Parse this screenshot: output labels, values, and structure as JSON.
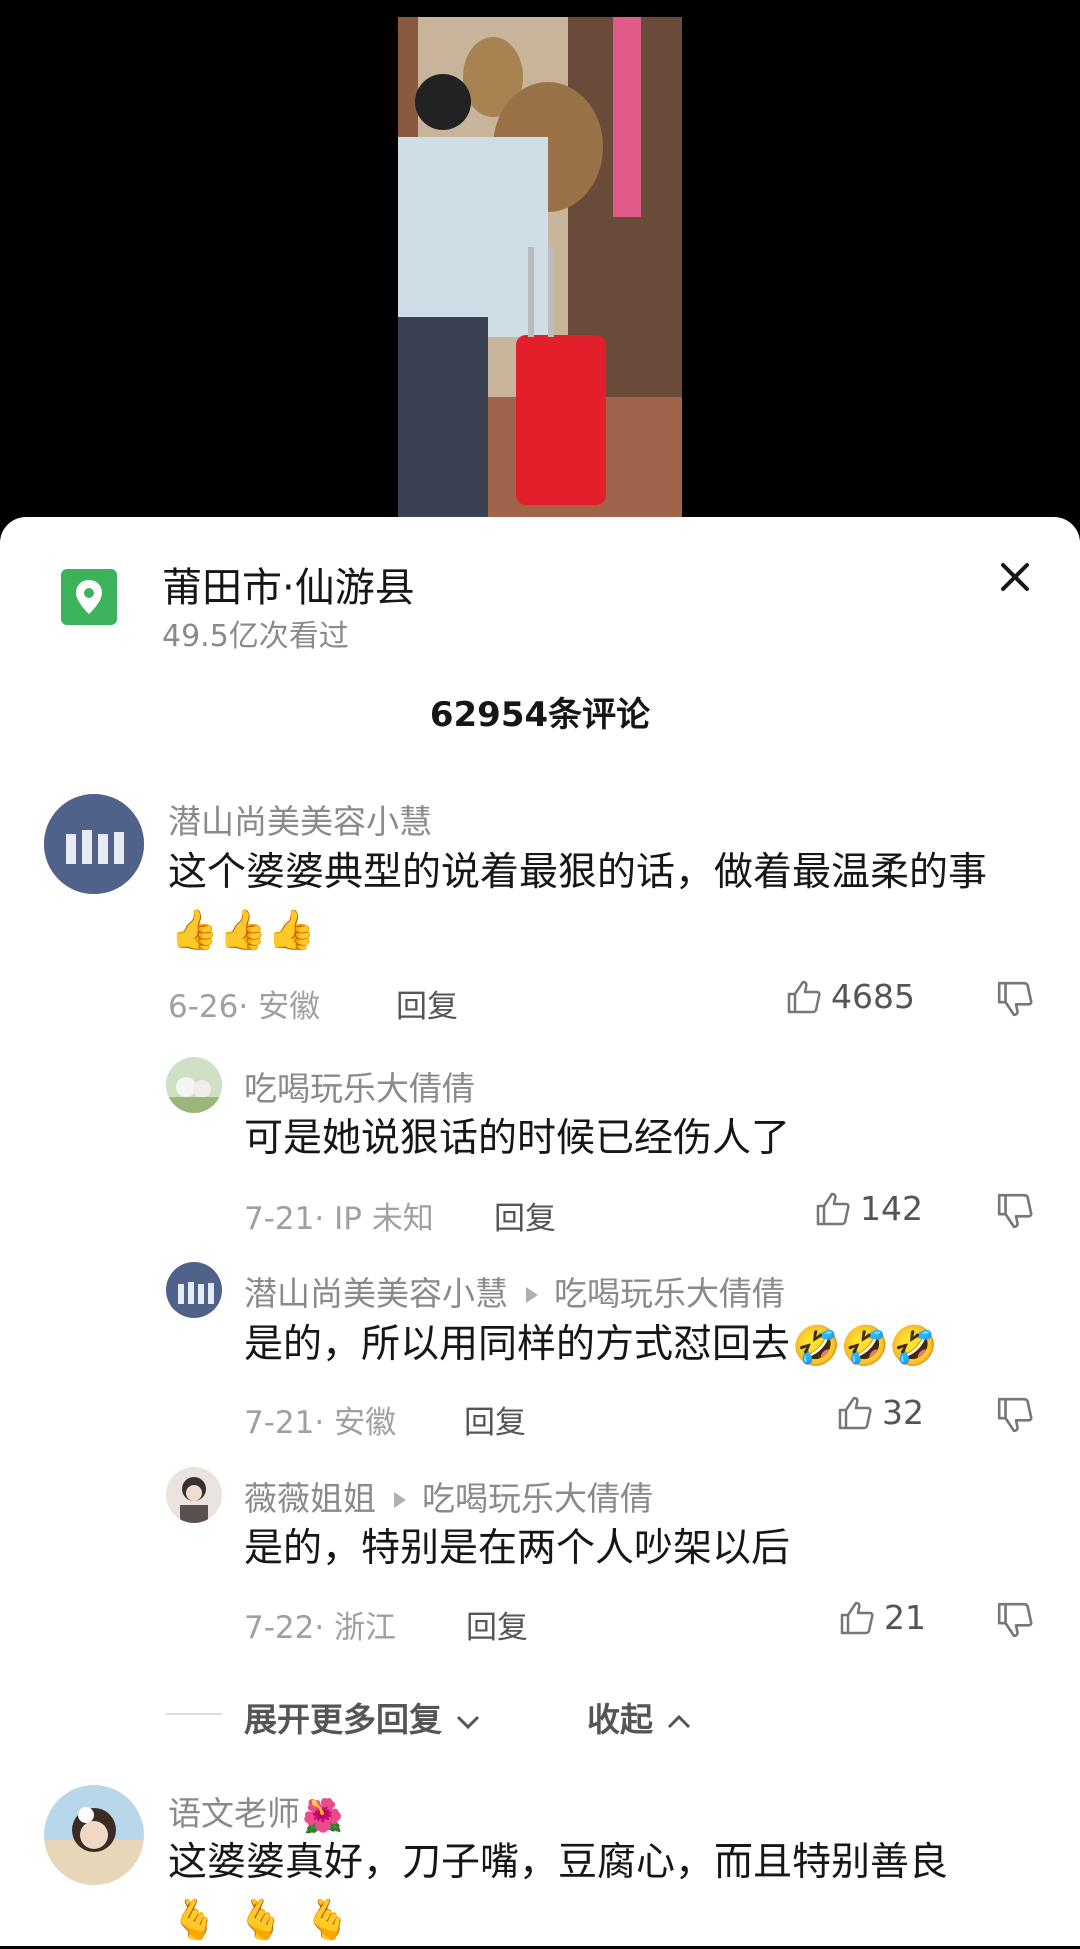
{
  "location": {
    "title": "莆田市·仙游县",
    "views": "49.5亿次看过",
    "icon": "map-pin-icon",
    "accent": "#3cb35a"
  },
  "comments_count": "62954条评论",
  "comments": [
    {
      "name": "潜山尚美美容小慧",
      "text": "这个婆婆典型的说着最狠的话，做着最温柔的事",
      "text_line2": "事",
      "emoji": "👍👍👍",
      "date_loc": "6-26· 安徽",
      "reply_label": "回复",
      "likes": "4685"
    },
    {
      "name": "吃喝玩乐大倩倩",
      "text": "可是她说狠话的时候已经伤人了",
      "date_loc": "7-21· IP 未知",
      "reply_label": "回复",
      "likes": "142"
    },
    {
      "name": "潜山尚美美容小慧",
      "reply_to": "吃喝玩乐大倩倩",
      "text": "是的，所以用同样的方式怼回去",
      "emoji": "🤣🤣🤣",
      "date_loc": "7-21· 安徽",
      "reply_label": "回复",
      "likes": "32"
    },
    {
      "name": "薇薇姐姐",
      "reply_to": "吃喝玩乐大倩倩",
      "text": "是的，特别是在两个人吵架以后",
      "date_loc": "7-22· 浙江",
      "reply_label": "回复",
      "likes": "21"
    },
    {
      "name": "语文老师",
      "name_emoji": "🌺",
      "text": "这婆婆真好，刀子嘴，豆腐心，而且特别善良",
      "emoji": "🫰🫰🫰"
    }
  ],
  "expand_label": "展开更多回复",
  "collapse_label": "收起"
}
